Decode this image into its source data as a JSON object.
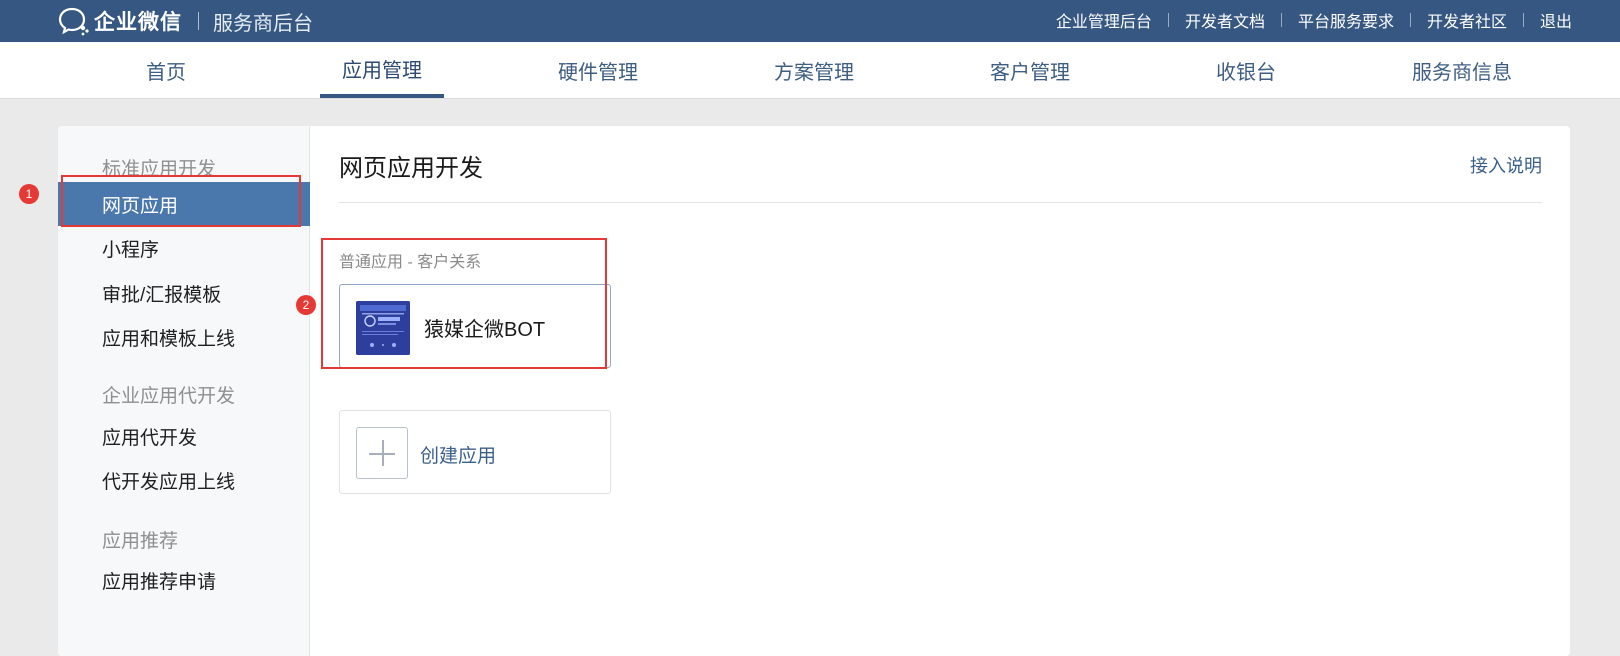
{
  "header": {
    "brand_name": "企业微信",
    "brand_sub": "服务商后台",
    "links": [
      "企业管理后台",
      "开发者文档",
      "平台服务要求",
      "开发者社区",
      "退出"
    ]
  },
  "nav": {
    "items": [
      "首页",
      "应用管理",
      "硬件管理",
      "方案管理",
      "客户管理",
      "收银台",
      "服务商信息"
    ],
    "active": "应用管理"
  },
  "sidebar": {
    "groups": [
      {
        "title": "标准应用开发",
        "items": [
          "网页应用",
          "小程序",
          "审批/汇报模板",
          "应用和模板上线"
        ]
      },
      {
        "title": "企业应用代开发",
        "items": [
          "应用代开发",
          "代开发应用上线"
        ]
      },
      {
        "title": "应用推荐",
        "items": [
          "应用推荐申请"
        ]
      }
    ],
    "active": "网页应用"
  },
  "main": {
    "title": "网页应用开发",
    "help_link": "接入说明",
    "section_label": "普通应用 - 客户关系",
    "app_name": "猿媒企微BOT",
    "create_label": "创建应用"
  },
  "annotations": {
    "badge1": "1",
    "badge2": "2"
  },
  "colors": {
    "topbar": "#355781",
    "active_side": "#4a77ac",
    "link": "#3a5f8b",
    "annotation": "#e53935"
  }
}
